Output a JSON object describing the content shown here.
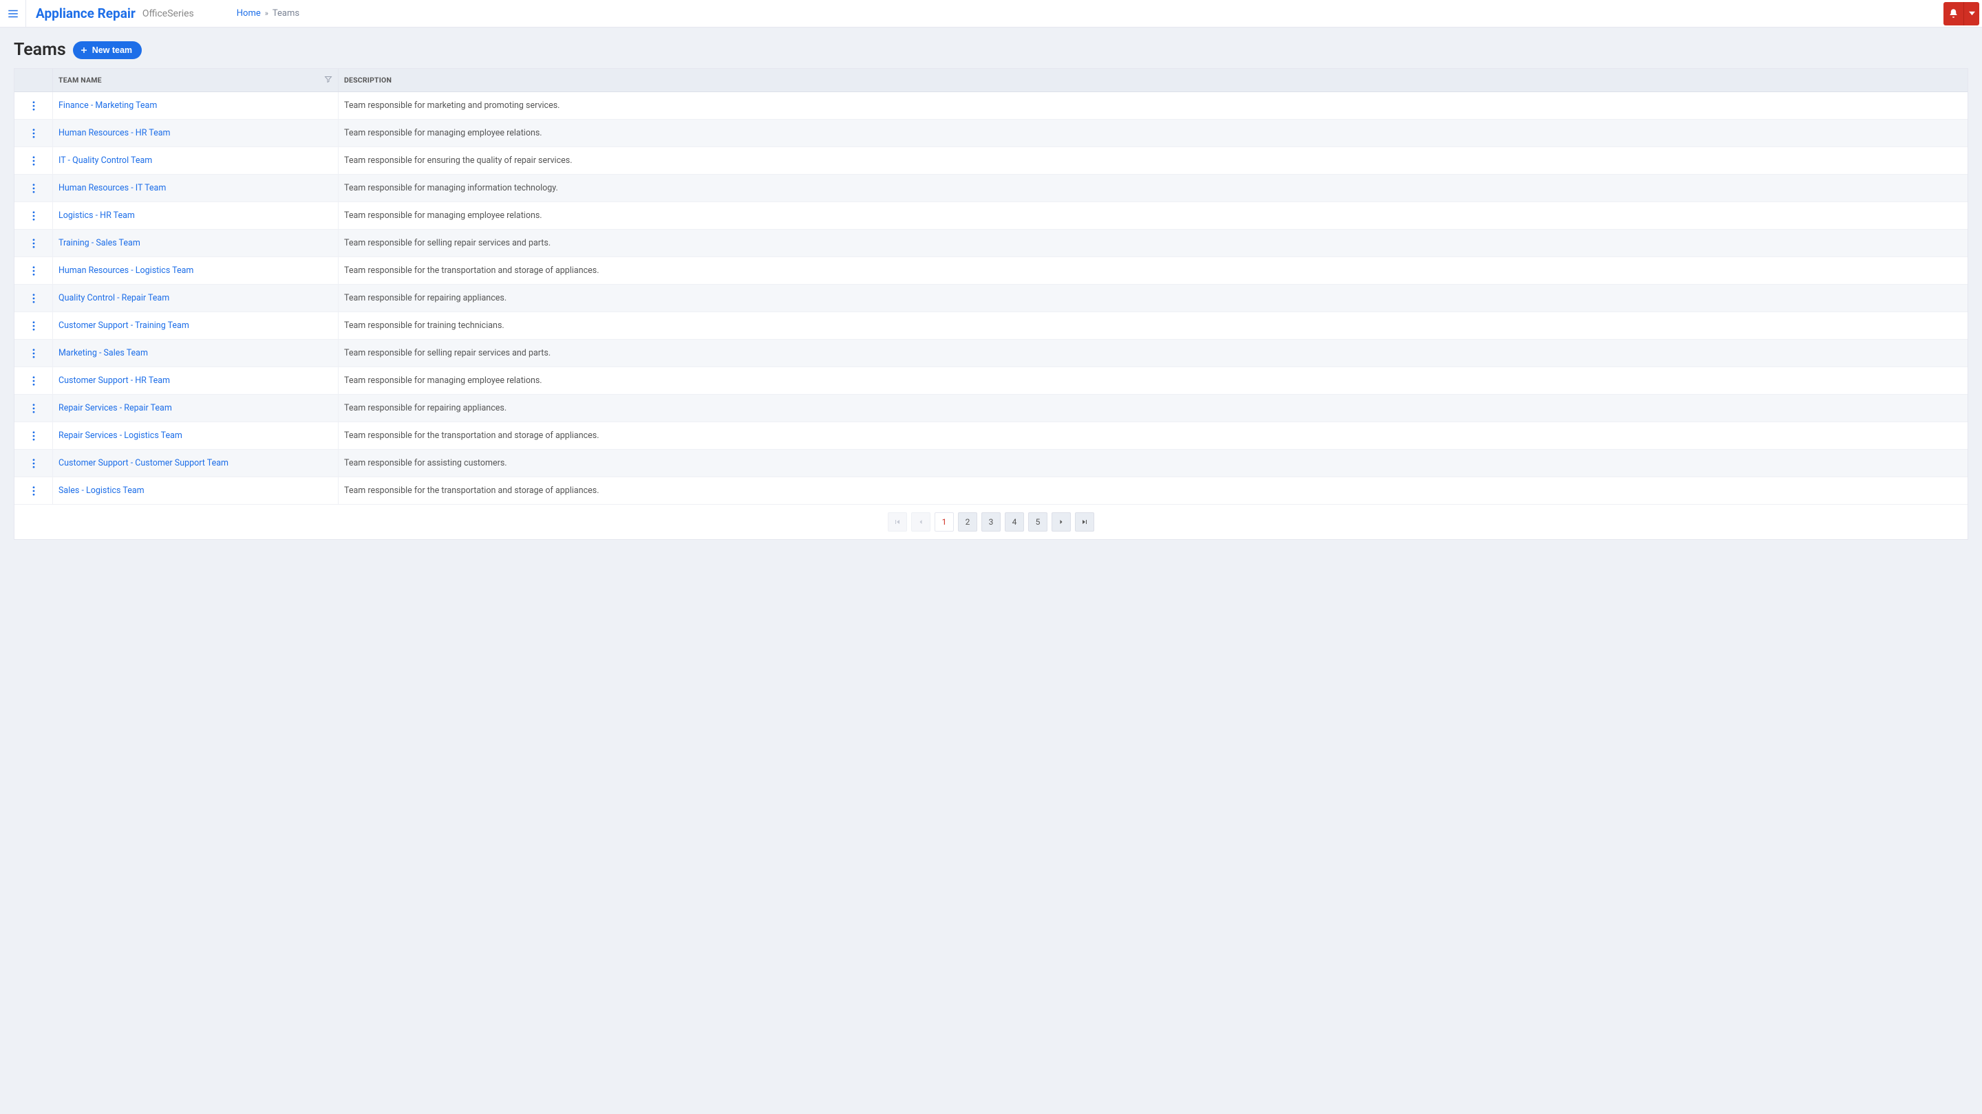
{
  "header": {
    "brand": "Appliance Repair",
    "subbrand": "OfficeSeries",
    "home_label": "Home",
    "current_label": "Teams"
  },
  "page": {
    "title": "Teams",
    "new_button_label": "New team"
  },
  "table": {
    "headers": {
      "name": "Team Name",
      "description": "Description"
    },
    "rows": [
      {
        "name": "Finance - Marketing Team",
        "description": "Team responsible for marketing and promoting services."
      },
      {
        "name": "Human Resources - HR Team",
        "description": "Team responsible for managing employee relations."
      },
      {
        "name": "IT - Quality Control Team",
        "description": "Team responsible for ensuring the quality of repair services."
      },
      {
        "name": "Human Resources - IT Team",
        "description": "Team responsible for managing information technology."
      },
      {
        "name": "Logistics - HR Team",
        "description": "Team responsible for managing employee relations."
      },
      {
        "name": "Training - Sales Team",
        "description": "Team responsible for selling repair services and parts."
      },
      {
        "name": "Human Resources - Logistics Team",
        "description": "Team responsible for the transportation and storage of appliances."
      },
      {
        "name": "Quality Control - Repair Team",
        "description": "Team responsible for repairing appliances."
      },
      {
        "name": "Customer Support - Training Team",
        "description": "Team responsible for training technicians."
      },
      {
        "name": "Marketing - Sales Team",
        "description": "Team responsible for selling repair services and parts."
      },
      {
        "name": "Customer Support - HR Team",
        "description": "Team responsible for managing employee relations."
      },
      {
        "name": "Repair Services - Repair Team",
        "description": "Team responsible for repairing appliances."
      },
      {
        "name": "Repair Services - Logistics Team",
        "description": "Team responsible for the transportation and storage of appliances."
      },
      {
        "name": "Customer Support - Customer Support Team",
        "description": "Team responsible for assisting customers."
      },
      {
        "name": "Sales - Logistics Team",
        "description": "Team responsible for the transportation and storage of appliances."
      }
    ]
  },
  "pagination": {
    "pages": [
      "1",
      "2",
      "3",
      "4",
      "5"
    ],
    "current": "1"
  }
}
